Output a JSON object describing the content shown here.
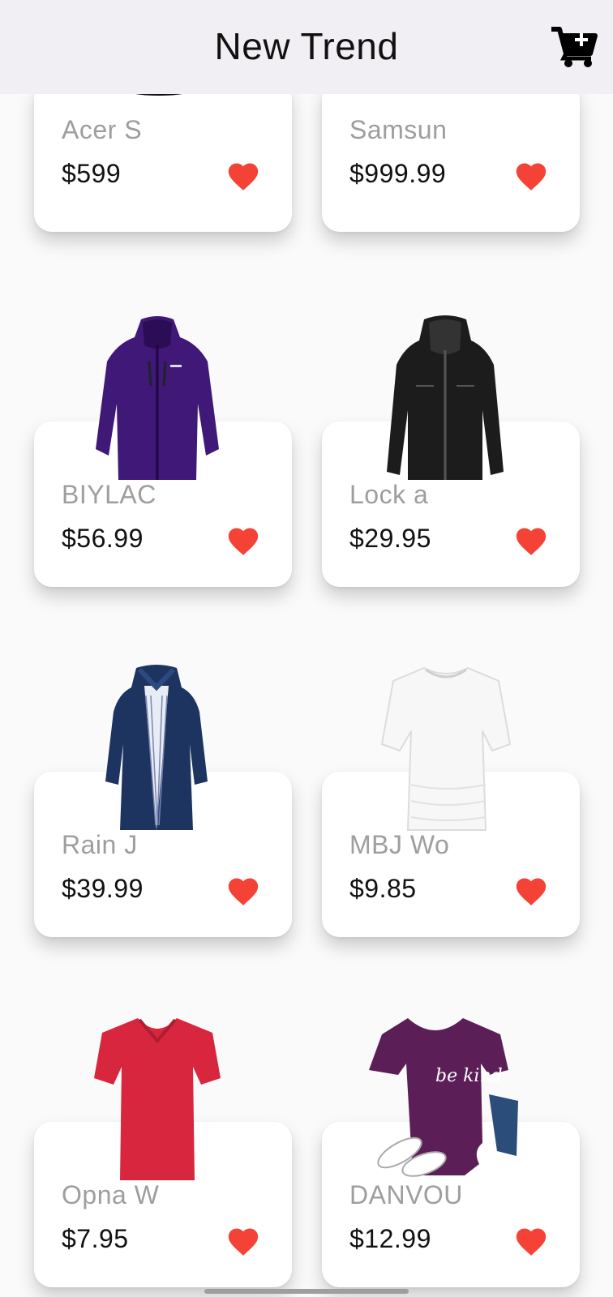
{
  "header": {
    "title": "New Trend",
    "cart_icon": "cart-plus-icon"
  },
  "products": [
    {
      "name": "Acer S",
      "price": "$599",
      "favorite": true,
      "image": "monitor-stand"
    },
    {
      "name": "Samsun",
      "price": "$999.99",
      "favorite": true,
      "image": "monitor-stand"
    },
    {
      "name": "BIYLAC",
      "price": "$56.99",
      "favorite": true,
      "image": "purple-jacket"
    },
    {
      "name": "Lock a",
      "price": "$29.95",
      "favorite": true,
      "image": "black-leather-jacket"
    },
    {
      "name": "Rain J",
      "price": "$39.99",
      "favorite": true,
      "image": "navy-rain-jacket"
    },
    {
      "name": "MBJ Wo",
      "price": "$9.85",
      "favorite": true,
      "image": "white-tshirt"
    },
    {
      "name": "Opna W",
      "price": "$7.95",
      "favorite": true,
      "image": "red-tshirt"
    },
    {
      "name": "DANVOU",
      "price": "$12.99",
      "favorite": true,
      "image": "purple-be-kind-tshirt",
      "image_text": "be kind"
    }
  ],
  "colors": {
    "heart": "#f44336",
    "appbar": "#f1eff4"
  }
}
